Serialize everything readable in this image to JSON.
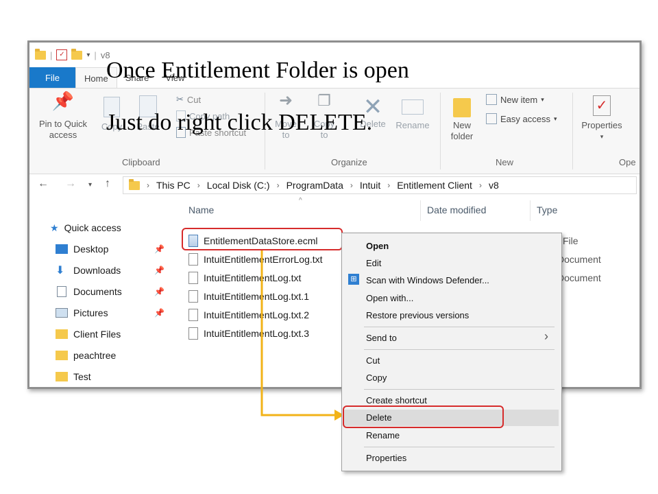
{
  "window": {
    "title": "v8",
    "tabs": {
      "file": "File",
      "home": "Home",
      "share": "Share",
      "view": "View"
    }
  },
  "ribbon": {
    "pin_label_1": "Pin to Quick",
    "pin_label_2": "access",
    "copy": "Copy",
    "paste": "Paste",
    "cut": "Cut",
    "copy_path": "Copy path",
    "paste_shortcut": "Paste shortcut",
    "move_to_1": "Move",
    "move_to_2": "to",
    "copy_to_1": "Copy",
    "copy_to_2": "to",
    "delete": "Delete",
    "rename": "Rename",
    "new_folder_1": "New",
    "new_folder_2": "folder",
    "new_item": "New item",
    "easy_access": "Easy access",
    "properties": "Properties",
    "groups": {
      "clipboard": "Clipboard",
      "organize": "Organize",
      "new": "New",
      "open": "Ope"
    }
  },
  "address": {
    "crumbs": [
      "This PC",
      "Local Disk (C:)",
      "ProgramData",
      "Intuit",
      "Entitlement Client",
      "v8"
    ]
  },
  "nav_pane": {
    "quick_access": "Quick access",
    "items": [
      "Desktop",
      "Downloads",
      "Documents",
      "Pictures",
      "Client Files",
      "peachtree",
      "Test"
    ]
  },
  "columns": {
    "name": "Name",
    "date_modified": "Date modified",
    "type": "Type"
  },
  "files": [
    {
      "name": "EntitlementDataStore.ecml",
      "type": "File"
    },
    {
      "name": "IntuitEntitlementErrorLog.txt",
      "type": "Document"
    },
    {
      "name": "IntuitEntitlementLog.txt",
      "type": "Document"
    },
    {
      "name": "IntuitEntitlementLog.txt.1",
      "type": ""
    },
    {
      "name": "IntuitEntitlementLog.txt.2",
      "type": ""
    },
    {
      "name": "IntuitEntitlementLog.txt.3",
      "type": ""
    }
  ],
  "context_menu": {
    "open": "Open",
    "edit": "Edit",
    "scan": "Scan with Windows Defender...",
    "open_with": "Open with...",
    "restore": "Restore previous versions",
    "send_to": "Send to",
    "cut": "Cut",
    "copy": "Copy",
    "create_shortcut": "Create shortcut",
    "delete": "Delete",
    "rename": "Rename",
    "properties": "Properties"
  },
  "captions": {
    "line1": "Once Entitlement Folder is open",
    "line2": "Just do right click DELETE."
  },
  "colors": {
    "accent": "#1979ca",
    "highlight": "#d62b2b",
    "arrow": "#f2b318"
  }
}
